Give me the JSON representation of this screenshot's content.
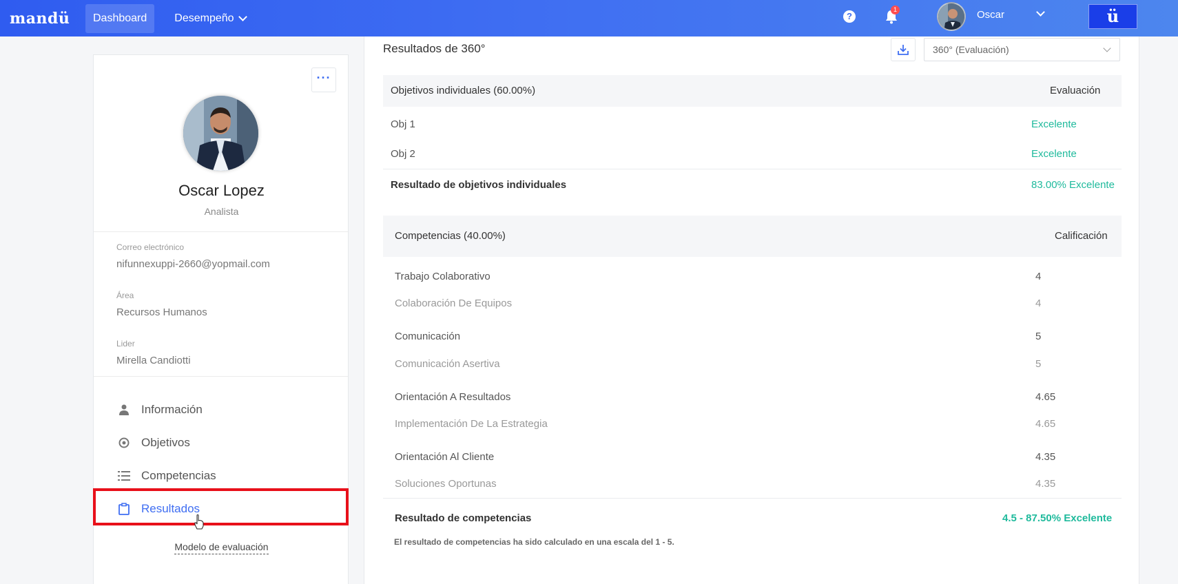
{
  "header": {
    "logo": "mandü",
    "nav": {
      "dashboard": "Dashboard",
      "desempeno": "Desempeño"
    },
    "help_glyph": "?",
    "notification_count": "1",
    "user_name": "Oscar",
    "brand_glyph": "ü"
  },
  "profile": {
    "more_glyph": "···",
    "name": "Oscar Lopez",
    "role": "Analista",
    "fields": [
      {
        "label": "Correo electrónico",
        "value": "nifunnexuppi-2660@yopmail.com"
      },
      {
        "label": "Área",
        "value": "Recursos Humanos"
      },
      {
        "label": "Lider",
        "value": "Mirella Candiotti"
      }
    ],
    "menu": [
      {
        "label": "Información",
        "icon": "person-icon"
      },
      {
        "label": "Objetivos",
        "icon": "target-icon"
      },
      {
        "label": "Competencias",
        "icon": "list-icon"
      },
      {
        "label": "Resultados",
        "icon": "clipboard-icon"
      }
    ],
    "model_link": "Modelo de evaluación"
  },
  "results": {
    "title": "Resultados de 360°",
    "select_value": "360° (Evaluación)",
    "objectives": {
      "header_left": "Objetivos individuales (60.00%)",
      "header_right": "Evaluación",
      "rows": [
        {
          "name": "Obj 1",
          "value": "Excelente"
        },
        {
          "name": "Obj 2",
          "value": "Excelente"
        }
      ],
      "total_label": "Resultado de objetivos individuales",
      "total_value": "83.00% Excelente"
    },
    "competencies": {
      "header_left": "Competencias (40.00%)",
      "header_right": "Calificación",
      "rows": [
        {
          "name": "Trabajo Colaborativo",
          "value": "4",
          "sub_name": "Colaboración De Equipos",
          "sub_value": "4"
        },
        {
          "name": "Comunicación",
          "value": "5",
          "sub_name": "Comunicación Asertiva",
          "sub_value": "5"
        },
        {
          "name": "Orientación A Resultados",
          "value": "4.65",
          "sub_name": "Implementación De La Estrategia",
          "sub_value": "4.65"
        },
        {
          "name": "Orientación Al Cliente",
          "value": "4.35",
          "sub_name": "Soluciones Oportunas",
          "sub_value": "4.35"
        }
      ],
      "total_label": "Resultado de competencias",
      "total_value": "4.5 - 87.50% Excelente",
      "note": "El resultado de competencias ha sido calculado en una escala del 1 - 5."
    }
  },
  "colors": {
    "accent": "#3f6ef2",
    "success": "#1fba9c",
    "highlight": "#e8101a"
  }
}
